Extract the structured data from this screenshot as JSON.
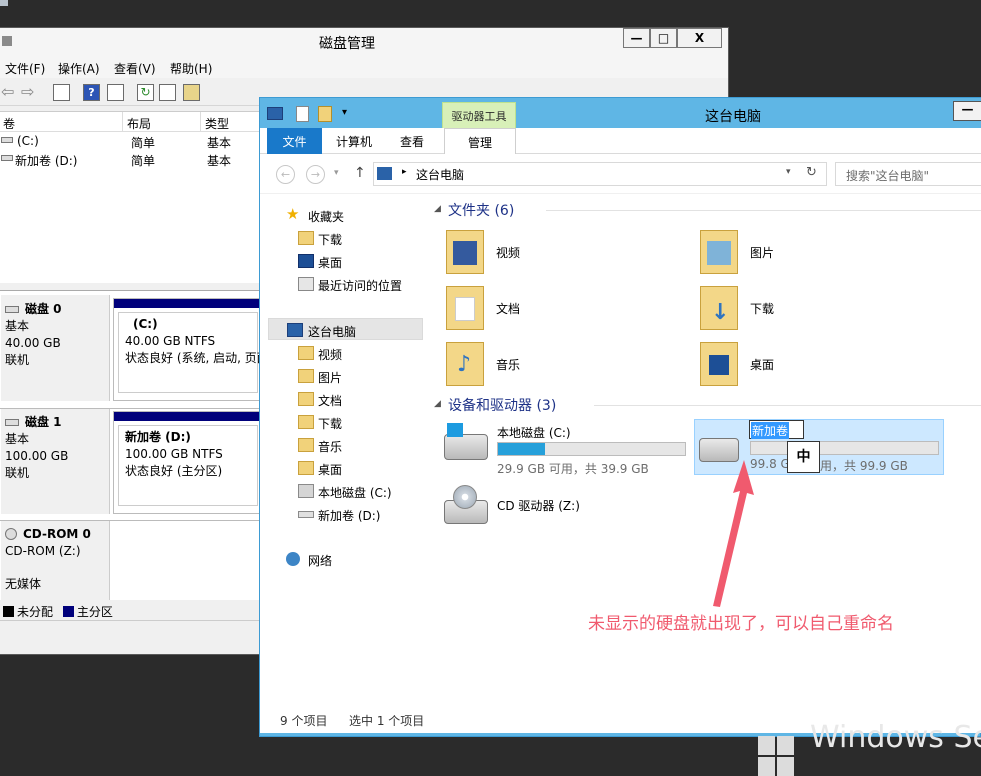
{
  "disk_mgmt": {
    "title": "磁盘管理",
    "controls": {
      "minimize": "—",
      "maximize": "□",
      "close": "X"
    },
    "menu": [
      "文件(F)",
      "操作(A)",
      "查看(V)",
      "帮助(H)"
    ],
    "columns": [
      "卷",
      "布局",
      "类型"
    ],
    "volumes": [
      {
        "name": "(C:)",
        "layout": "简单",
        "type": "基本"
      },
      {
        "name": "新加卷 (D:)",
        "layout": "简单",
        "type": "基本"
      }
    ],
    "disks": [
      {
        "name": "磁盘 0",
        "kind": "基本",
        "size": "40.00 GB",
        "state": "联机",
        "part_title": "(C:)",
        "part_size": "40.00 GB NTFS",
        "part_status": "状态良好 (系统, 启动, 页面"
      },
      {
        "name": "磁盘 1",
        "kind": "基本",
        "size": "100.00 GB",
        "state": "联机",
        "part_title": "新加卷  (D:)",
        "part_size": "100.00 GB NTFS",
        "part_status": "状态良好 (主分区)"
      },
      {
        "name": "CD-ROM 0",
        "kind": "CD-ROM (Z:)",
        "media": "无媒体"
      }
    ],
    "legend": {
      "unallocated": "未分配",
      "primary": "主分区",
      "color_unallocated": "#000000",
      "color_primary": "#00007b"
    }
  },
  "explorer": {
    "title": "这台电脑",
    "context_tab_group": "驱动器工具",
    "tabs": {
      "file": "文件",
      "computer": "计算机",
      "view": "查看",
      "manage": "管理"
    },
    "address": "这台电脑",
    "search_placeholder": "搜索\"这台电脑\"",
    "nav": {
      "favorites": "收藏夹",
      "fav_items": [
        "下载",
        "桌面",
        "最近访问的位置"
      ],
      "thispc": "这台电脑",
      "pc_items": [
        "视频",
        "图片",
        "文档",
        "下载",
        "音乐",
        "桌面",
        "本地磁盘 (C:)",
        "新加卷 (D:)"
      ],
      "network": "网络"
    },
    "folders_header": "文件夹 (6)",
    "folders": [
      "视频",
      "图片",
      "文档",
      "下载",
      "音乐",
      "桌面"
    ],
    "devices_header": "设备和驱动器 (3)",
    "drives": {
      "c": {
        "name": "本地磁盘 (C:)",
        "free": "29.9 GB 可用，共 39.9 GB",
        "used_fraction": 0.25
      },
      "d": {
        "rename_value": "新加卷",
        "free_tail": "99.8 G",
        "free_rest": "用，共 99.9 GB",
        "used_fraction": 0.0,
        "ime": "中"
      },
      "z": {
        "name": "CD 驱动器 (Z:)"
      }
    },
    "status_left": "9 个项目",
    "status_right": "选中 1 个项目"
  },
  "annotation": "未显示的硬盘就出现了，可以自己重命名",
  "watermark": "Windows Se"
}
